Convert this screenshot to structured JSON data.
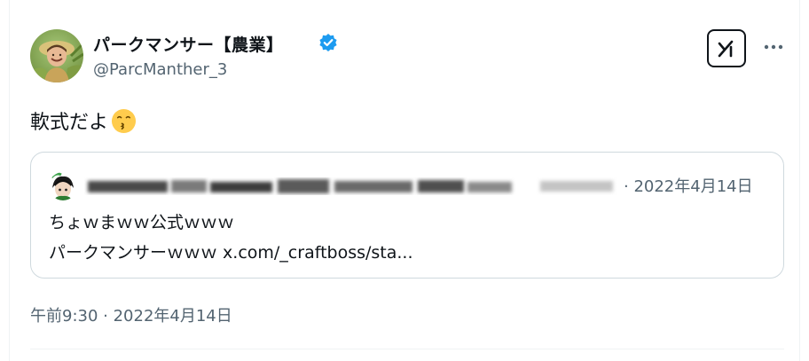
{
  "author": {
    "display_name": "パークマンサー【農業】",
    "handle": "@ParcManther_3",
    "verified": true
  },
  "tweet": {
    "text": "軟式だよ",
    "emoji": "kissing-face"
  },
  "quote": {
    "date": "· 2022年4月14日",
    "line1": "ちょｗまｗｗ公式ｗｗｗ",
    "line2_text": "パークマンサーｗｗｗ ",
    "line2_link": "x.com/_craftboss/sta..."
  },
  "timestamp": "午前9:30 · 2022年4月14日",
  "colors": {
    "text": "#0f1419",
    "secondary": "#536471",
    "verified": "#1d9bf0",
    "border": "#cfd9de"
  },
  "icons": {
    "verified": "verified-badge-icon",
    "grok": "grok-icon",
    "more": "more-horizontal-icon"
  }
}
